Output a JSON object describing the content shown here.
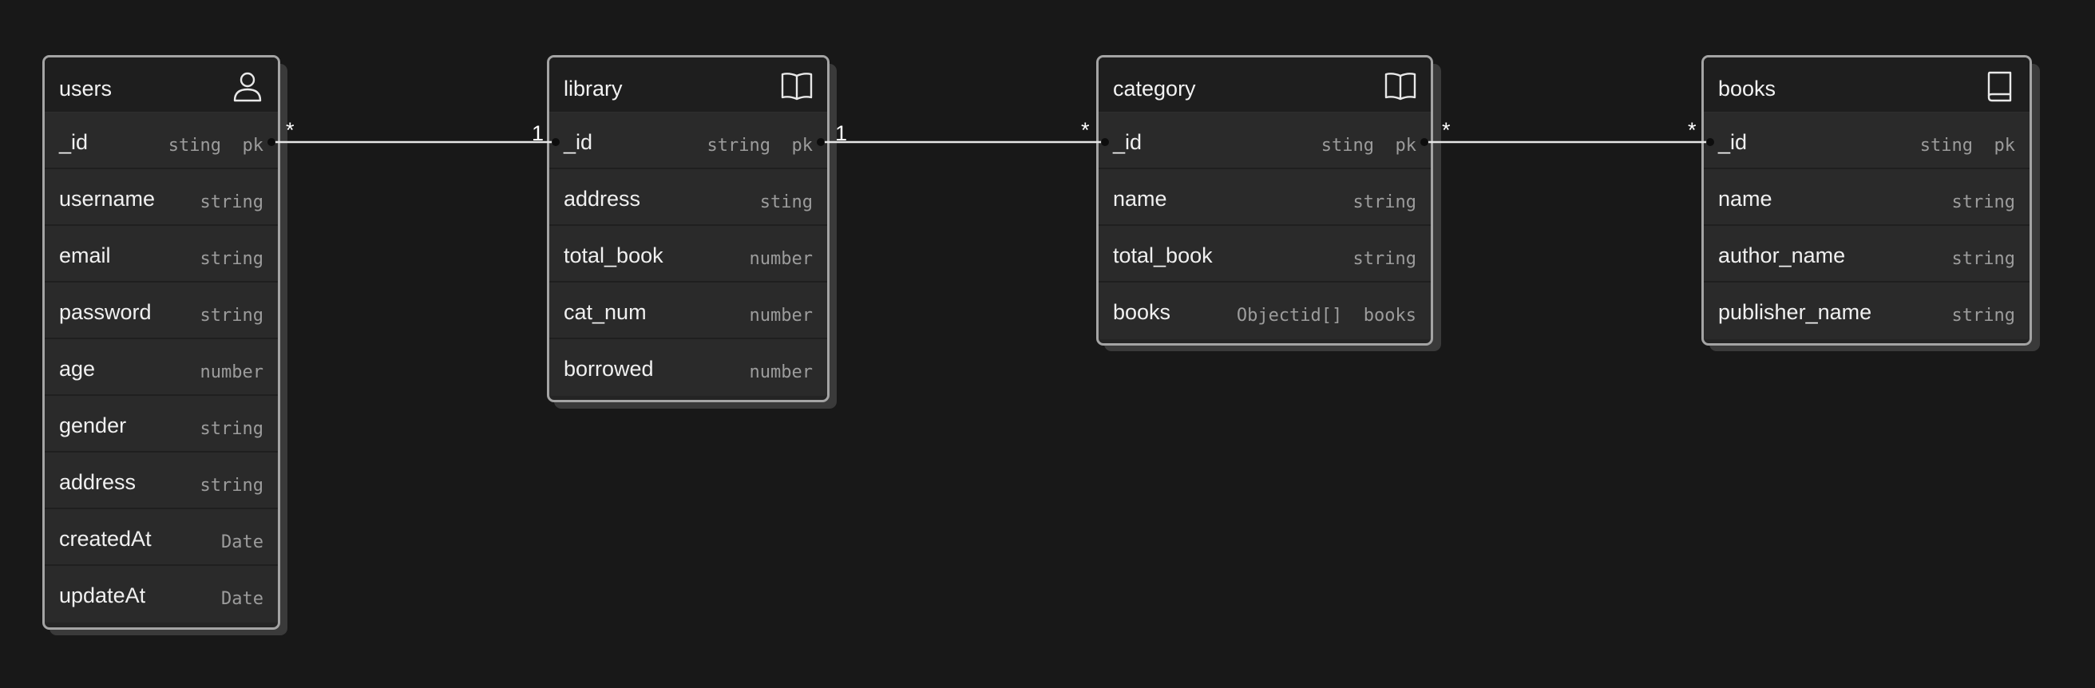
{
  "entities": {
    "users": {
      "title": "users",
      "icon": "user-icon",
      "fields": [
        {
          "name": "_id",
          "type": "sting  pk"
        },
        {
          "name": "username",
          "type": "string"
        },
        {
          "name": "email",
          "type": "string"
        },
        {
          "name": "password",
          "type": "string"
        },
        {
          "name": "age",
          "type": "number"
        },
        {
          "name": "gender",
          "type": "string"
        },
        {
          "name": "address",
          "type": "string"
        },
        {
          "name": "createdAt",
          "type": "Date"
        },
        {
          "name": "updateAt",
          "type": "Date"
        }
      ]
    },
    "library": {
      "title": "library",
      "icon": "open-book-icon",
      "fields": [
        {
          "name": "_id",
          "type": "string  pk"
        },
        {
          "name": "address",
          "type": "sting"
        },
        {
          "name": "total_book",
          "type": "number"
        },
        {
          "name": "cat_num",
          "type": "number"
        },
        {
          "name": "borrowed",
          "type": "number"
        }
      ]
    },
    "category": {
      "title": "category",
      "icon": "open-book-icon",
      "fields": [
        {
          "name": "_id",
          "type": "sting  pk"
        },
        {
          "name": "name",
          "type": "string"
        },
        {
          "name": "total_book",
          "type": "string"
        },
        {
          "name": "books",
          "type": "Objectid[]  books"
        }
      ]
    },
    "books": {
      "title": "books",
      "icon": "closed-book-icon",
      "fields": [
        {
          "name": "_id",
          "type": "sting  pk"
        },
        {
          "name": "name",
          "type": "string"
        },
        {
          "name": "author_name",
          "type": "string"
        },
        {
          "name": "publisher_name",
          "type": "string"
        }
      ]
    }
  },
  "relations": [
    {
      "from": "users",
      "to": "library",
      "from_card": "*",
      "to_card": "1"
    },
    {
      "from": "library",
      "to": "category",
      "from_card": "1",
      "to_card": "*"
    },
    {
      "from": "category",
      "to": "books",
      "from_card": "*",
      "to_card": "*"
    }
  ],
  "colors": {
    "background": "#181818",
    "border": "#a4a4a4",
    "row": "#2a2a2a",
    "connector": "#e6e6e6"
  }
}
